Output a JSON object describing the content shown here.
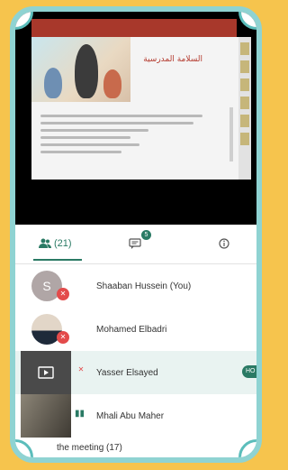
{
  "presentation": {
    "slide_title": "السلامة المدرسية"
  },
  "tabs": {
    "people_count": "(21)",
    "chat_badge": "5",
    "people_icon": "people-icon",
    "chat_icon": "chat-icon",
    "info_icon": "info-icon"
  },
  "participants": [
    {
      "initial": "S",
      "name": "Shaaban Hussein (You)",
      "muted": true
    },
    {
      "initial": "",
      "name": "Mohamed Elbadri",
      "muted": true
    },
    {
      "initial": "",
      "name": "Yasser Elsayed",
      "muted": true,
      "badge": "HO"
    },
    {
      "initial": "",
      "name": "Mhali Abu Maher",
      "muted": false
    }
  ],
  "section_label": "the meeting (17)",
  "colors": {
    "accent": "#2a7a64",
    "frame": "#8fd3d2",
    "background": "#f6c44d",
    "muted": "#e34b4b"
  }
}
